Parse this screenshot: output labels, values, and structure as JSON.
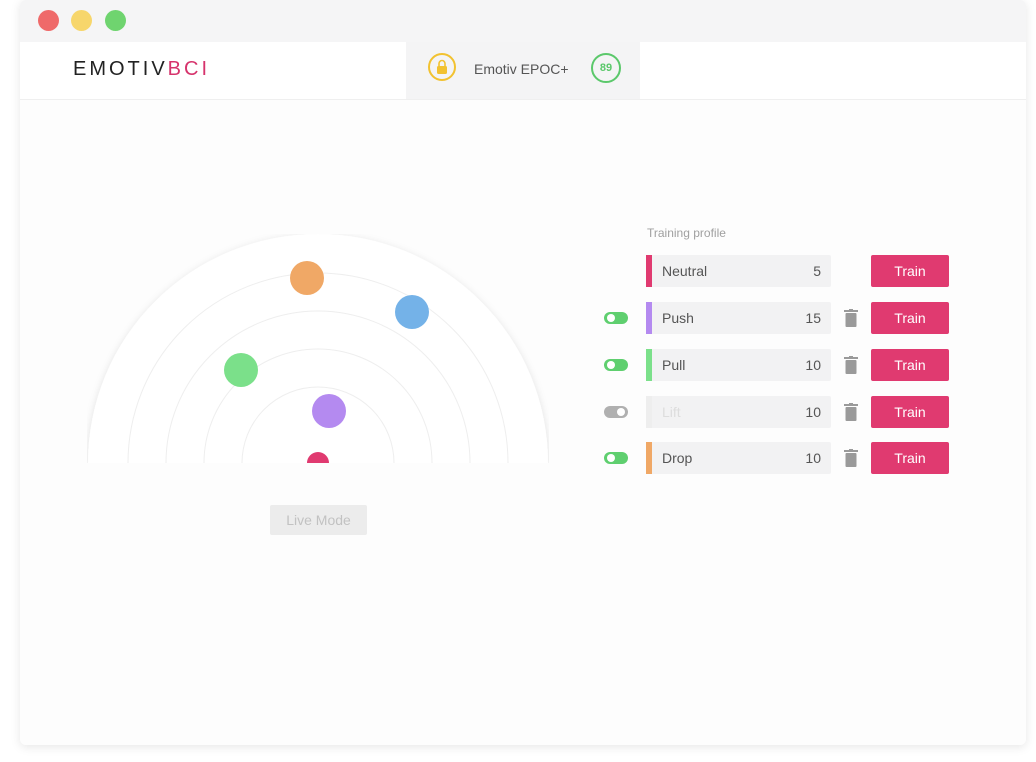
{
  "window": {
    "controls": [
      "close-dot",
      "minimize-dot",
      "maximize-dot"
    ]
  },
  "header": {
    "logo_main": "EMOTIV",
    "logo_accent": "BCI",
    "device_name": "Emotiv EPOC+",
    "battery_level": "89",
    "lock_icon": "lock-icon"
  },
  "radar": {
    "markers": [
      {
        "name": "Neutral",
        "color": "#e03a70"
      },
      {
        "name": "Push",
        "color": "#b48af0"
      },
      {
        "name": "Pull",
        "color": "#7be08a"
      },
      {
        "name": "Lift",
        "color": "#74b2e8"
      },
      {
        "name": "Drop",
        "color": "#f0a866"
      }
    ]
  },
  "live_mode_label": "Live Mode",
  "training": {
    "title": "Training profile",
    "train_label": "Train",
    "commands": [
      {
        "name": "Neutral",
        "count": "5",
        "color": "#e03a70",
        "toggle": null,
        "deletable": false,
        "enabled": true
      },
      {
        "name": "Push",
        "count": "15",
        "color": "#b48af0",
        "toggle": "on",
        "deletable": true,
        "enabled": true
      },
      {
        "name": "Pull",
        "count": "10",
        "color": "#7be08a",
        "toggle": "on",
        "deletable": true,
        "enabled": true
      },
      {
        "name": "Lift",
        "count": "10",
        "color": "#eeeeee",
        "toggle": "off",
        "deletable": true,
        "enabled": false
      },
      {
        "name": "Drop",
        "count": "10",
        "color": "#f0a866",
        "toggle": "on",
        "deletable": true,
        "enabled": true
      }
    ]
  }
}
